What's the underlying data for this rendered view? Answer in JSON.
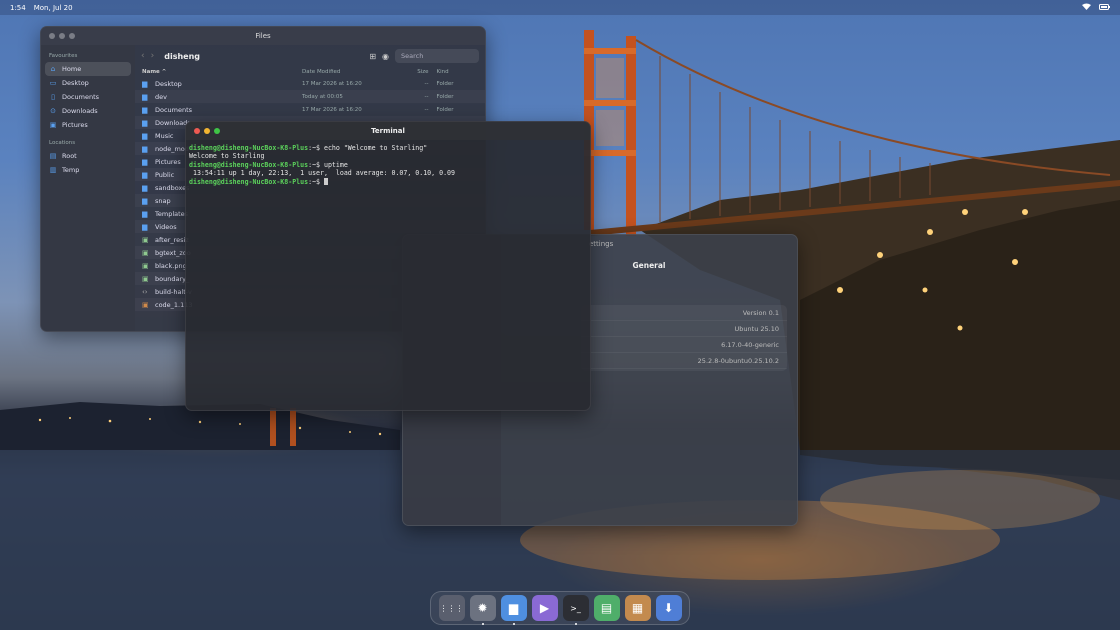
{
  "topbar": {
    "time": "1:54",
    "date": "Mon, Jul 20"
  },
  "files": {
    "title": "Files",
    "sidebar": {
      "favourites_heading": "Favourites",
      "favourites": [
        {
          "label": "Home",
          "icon": "home-icon"
        },
        {
          "label": "Desktop",
          "icon": "desktop-icon"
        },
        {
          "label": "Documents",
          "icon": "document-icon"
        },
        {
          "label": "Downloads",
          "icon": "download-icon"
        },
        {
          "label": "Pictures",
          "icon": "picture-icon"
        }
      ],
      "locations_heading": "Locations",
      "locations": [
        {
          "label": "Root",
          "icon": "drive-icon"
        },
        {
          "label": "Temp",
          "icon": "trash-icon"
        }
      ]
    },
    "path": "disheng",
    "search_placeholder": "Search",
    "columns": {
      "name": "Name ^",
      "date": "Date Modified",
      "size": "Size",
      "kind": "Kind"
    },
    "rows": [
      {
        "name": "Desktop",
        "date": "17 Mar 2026 at 16:20",
        "size": "--",
        "kind": "Folder"
      },
      {
        "name": "dev",
        "date": "Today at 00:05",
        "size": "--",
        "kind": "Folder"
      },
      {
        "name": "Documents",
        "date": "17 Mar 2026 at 16:20",
        "size": "--",
        "kind": "Folder"
      },
      {
        "name": "Downloads",
        "date": "",
        "size": "",
        "kind": ""
      },
      {
        "name": "Music",
        "date": "",
        "size": "",
        "kind": ""
      },
      {
        "name": "node_mod",
        "date": "",
        "size": "",
        "kind": ""
      },
      {
        "name": "Pictures",
        "date": "",
        "size": "",
        "kind": ""
      },
      {
        "name": "Public",
        "date": "",
        "size": "",
        "kind": ""
      },
      {
        "name": "sandboxes",
        "date": "",
        "size": "",
        "kind": ""
      },
      {
        "name": "snap",
        "date": "",
        "size": "",
        "kind": ""
      },
      {
        "name": "Templates",
        "date": "",
        "size": "",
        "kind": ""
      },
      {
        "name": "Videos",
        "date": "",
        "size": "",
        "kind": ""
      },
      {
        "name": "after_resiz",
        "date": "",
        "size": "",
        "kind": ""
      },
      {
        "name": "bgtext_zoo",
        "date": "",
        "size": "",
        "kind": ""
      },
      {
        "name": "black.png",
        "date": "",
        "size": "",
        "kind": ""
      },
      {
        "name": "boundary_",
        "date": "",
        "size": "",
        "kind": ""
      },
      {
        "name": "build-halt-v",
        "date": "",
        "size": "",
        "kind": ""
      },
      {
        "name": "code_1.113",
        "date": "",
        "size": "",
        "kind": ""
      }
    ]
  },
  "terminal": {
    "title": "Terminal",
    "lines": [
      {
        "prompt": "disheng@disheng-NucBox-K8-Plus",
        "suffix": ":~$ ",
        "text": "echo \"Welcome to Starling\""
      },
      {
        "prompt": "",
        "suffix": "",
        "text": "Welcome to Starling"
      },
      {
        "prompt": "disheng@disheng-NucBox-K8-Plus",
        "suffix": ":~$ ",
        "text": "uptime"
      },
      {
        "prompt": "",
        "suffix": "",
        "text": " 13:54:11 up 1 day, 22:13,  1 user,  load average: 0.07, 0.10, 0.09"
      },
      {
        "prompt": "disheng@disheng-NucBox-K8-Plus",
        "suffix": ":~$ ",
        "text": ""
      }
    ]
  },
  "settings": {
    "title_partial": "ettings",
    "heading": "General",
    "rows": [
      "Version 0.1",
      "Ubuntu 25.10",
      "6.17.0-40-generic",
      "25.2.8-0ubuntu0.25.10.2"
    ]
  },
  "dock": {
    "items": [
      {
        "name": "app-grid-icon",
        "bg": "#5a5f6e",
        "glyph": "⋮⋮⋮",
        "running": false
      },
      {
        "name": "settings-app-icon",
        "bg": "#6c7280",
        "glyph": "✹",
        "running": true
      },
      {
        "name": "files-app-icon",
        "bg": "#4f8fe0",
        "glyph": "▆",
        "running": true
      },
      {
        "name": "media-player-icon",
        "bg": "#8a6ad4",
        "glyph": "▶",
        "running": false
      },
      {
        "name": "terminal-app-icon",
        "bg": "#2c2e34",
        "glyph": ">_",
        "running": true
      },
      {
        "name": "text-editor-icon",
        "bg": "#4fae6a",
        "glyph": "▤",
        "running": false
      },
      {
        "name": "calculator-icon",
        "bg": "#c38a4e",
        "glyph": "▦",
        "running": false
      },
      {
        "name": "software-center-icon",
        "bg": "#4f7ed6",
        "glyph": "⬇",
        "running": false
      }
    ]
  }
}
